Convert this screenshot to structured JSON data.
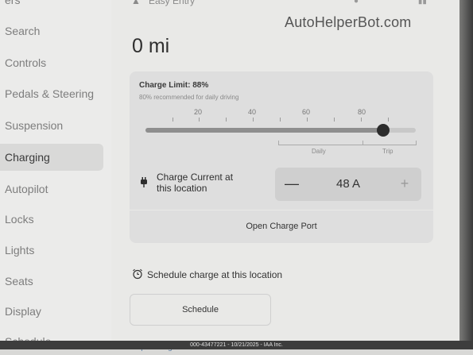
{
  "top": {
    "sidebar_cut_label": "ers",
    "mode_label": "Easy Entry"
  },
  "watermark": "AutoHelperBot.com",
  "sidebar": {
    "items": [
      {
        "label": "Search"
      },
      {
        "label": "Controls"
      },
      {
        "label": "Pedals & Steering"
      },
      {
        "label": "Suspension"
      },
      {
        "label": "Charging",
        "active": true
      },
      {
        "label": "Autopilot"
      },
      {
        "label": "Locks"
      },
      {
        "label": "Lights"
      },
      {
        "label": "Seats"
      },
      {
        "label": "Display"
      },
      {
        "label": "Schedule"
      }
    ]
  },
  "range": "0 mi",
  "charge": {
    "limit_title": "Charge Limit: 88%",
    "limit_subtitle": "80% recommended for daily driving",
    "limit_percent": 88,
    "scale_labels": [
      "20",
      "40",
      "60",
      "80"
    ],
    "range_labels": {
      "daily": "Daily",
      "trip": "Trip"
    },
    "current_label_1": "Charge Current at",
    "current_label_2": "this location",
    "current_value": "48 A",
    "minus_symbol": "—",
    "plus_symbol": "+",
    "open_port_label": "Open Charge Port"
  },
  "schedule": {
    "heading": "Schedule charge at this location",
    "button_label": "Schedule",
    "cut_label": "Supercharge"
  },
  "footer": "000-43477221 - 10/21/2025 - IAA Inc."
}
